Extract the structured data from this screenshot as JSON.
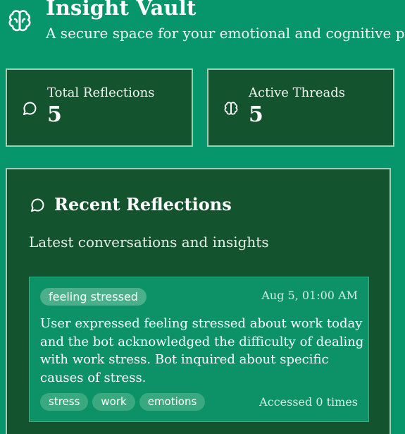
{
  "header": {
    "title": "Insight Vault",
    "subtitle": "A secure space for your emotional and cognitive patt",
    "logo_icon": "brain-icon"
  },
  "stats": [
    {
      "label": "Total Reflections",
      "value": "5",
      "icon": "message-circle-icon"
    },
    {
      "label": "Active Threads",
      "value": "5",
      "icon": "brain-icon"
    }
  ],
  "recent": {
    "title": "Recent Reflections",
    "subtitle": "Latest conversations and insights",
    "icon": "message-circle-icon",
    "items": [
      {
        "topic": "feeling stressed",
        "timestamp": "Aug 5, 01:00 AM",
        "summary": "User expressed feeling stressed about work today and the bot acknowledged the difficulty of dealing with work stress. Bot inquired about specific causes of stress.",
        "keywords": [
          "stress",
          "work",
          "emotions"
        ],
        "access_count": "Accessed 0 times"
      }
    ]
  },
  "colors": {
    "background": "#07956b",
    "card": "#13532e",
    "card_border": "#9fd0b6",
    "reflection_card": "#0d9267",
    "tag": "#3ba97f"
  }
}
